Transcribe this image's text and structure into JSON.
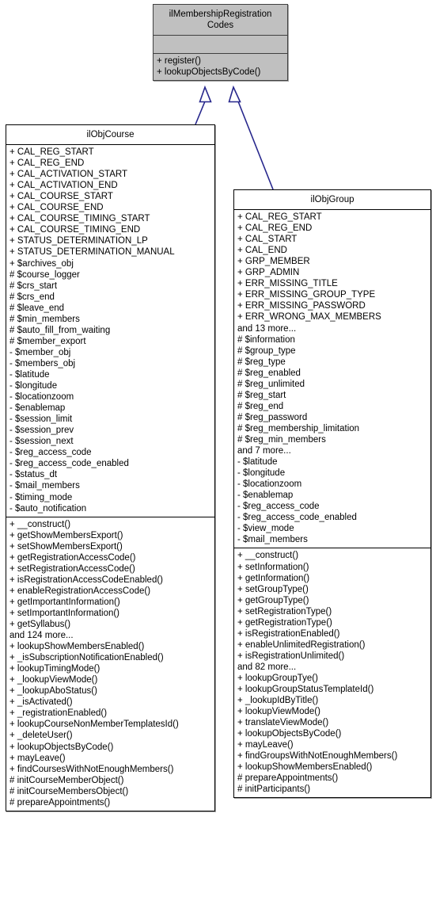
{
  "diagram": {
    "type": "uml-class-diagram",
    "background": "#ffffff",
    "edge_color": "#26268c",
    "interface_fill": "#c0c0c0",
    "class_fill": "#ffffff",
    "border_color": "#000000"
  },
  "classes": {
    "membership_registration_codes": {
      "name": "ilMembershipRegistration\nCodes",
      "attributes": [],
      "methods": [
        "+ register()",
        "+ lookupObjectsByCode()"
      ]
    },
    "obj_course": {
      "name": "ilObjCourse",
      "attributes": [
        "+ CAL_REG_START",
        "+ CAL_REG_END",
        "+ CAL_ACTIVATION_START",
        "+ CAL_ACTIVATION_END",
        "+ CAL_COURSE_START",
        "+ CAL_COURSE_END",
        "+ CAL_COURSE_TIMING_START",
        "+ CAL_COURSE_TIMING_END",
        "+ STATUS_DETERMINATION_LP",
        "+ STATUS_DETERMINATION_MANUAL",
        "+ $archives_obj",
        "# $course_logger",
        "# $crs_start",
        "# $crs_end",
        "# $leave_end",
        "# $min_members",
        "# $auto_fill_from_waiting",
        "# $member_export",
        "- $member_obj",
        "- $members_obj",
        "- $latitude",
        "- $longitude",
        "- $locationzoom",
        "- $enablemap",
        "- $session_limit",
        "- $session_prev",
        "- $session_next",
        "- $reg_access_code",
        "- $reg_access_code_enabled",
        "- $status_dt",
        "- $mail_members",
        "- $timing_mode",
        "- $auto_notification"
      ],
      "methods": [
        "+ __construct()",
        "+ getShowMembersExport()",
        "+ setShowMembersExport()",
        "+ getRegistrationAccessCode()",
        "+ setRegistrationAccessCode()",
        "+ isRegistrationAccessCodeEnabled()",
        "+ enableRegistrationAccessCode()",
        "+ getImportantInformation()",
        "+ setImportantInformation()",
        "+ getSyllabus()",
        "and 124 more...",
        "+ lookupShowMembersEnabled()",
        "+ _isSubscriptionNotificationEnabled()",
        "+ lookupTimingMode()",
        "+ _lookupViewMode()",
        "+ _lookupAboStatus()",
        "+ _isActivated()",
        "+ _registrationEnabled()",
        "+ lookupCourseNonMemberTemplatesId()",
        "+ _deleteUser()",
        "+ lookupObjectsByCode()",
        "+ mayLeave()",
        "+ findCoursesWithNotEnoughMembers()",
        "# initCourseMemberObject()",
        "# initCourseMembersObject()",
        "# prepareAppointments()"
      ]
    },
    "obj_group": {
      "name": "ilObjGroup",
      "attributes": [
        "+ CAL_REG_START",
        "+ CAL_REG_END",
        "+ CAL_START",
        "+ CAL_END",
        "+ GRP_MEMBER",
        "+ GRP_ADMIN",
        "+ ERR_MISSING_TITLE",
        "+ ERR_MISSING_GROUP_TYPE",
        "+ ERR_MISSING_PASSWORD",
        "+ ERR_WRONG_MAX_MEMBERS",
        "and 13 more...",
        "# $information",
        "# $group_type",
        "# $reg_type",
        "# $reg_enabled",
        "# $reg_unlimited",
        "# $reg_start",
        "# $reg_end",
        "# $reg_password",
        "# $reg_membership_limitation",
        "# $reg_min_members",
        "and 7 more...",
        "- $latitude",
        "- $longitude",
        "- $locationzoom",
        "- $enablemap",
        "- $reg_access_code",
        "- $reg_access_code_enabled",
        "- $view_mode",
        "- $mail_members"
      ],
      "methods": [
        "+ __construct()",
        "+ setInformation()",
        "+ getInformation()",
        "+ setGroupType()",
        "+ getGroupType()",
        "+ setRegistrationType()",
        "+ getRegistrationType()",
        "+ isRegistrationEnabled()",
        "+ enableUnlimitedRegistration()",
        "+ isRegistrationUnlimited()",
        "and 82 more...",
        "+ lookupGroupTye()",
        "+ lookupGroupStatusTemplateId()",
        "+ _lookupIdByTitle()",
        "+ lookupViewMode()",
        "+ translateViewMode()",
        "+ lookupObjectsByCode()",
        "+ mayLeave()",
        "+ findGroupsWithNotEnoughMembers()",
        "+ lookupShowMembersEnabled()",
        "# prepareAppointments()",
        "# initParticipants()"
      ]
    }
  },
  "relationships": [
    {
      "from": "ilObjCourse",
      "to": "ilMembershipRegistrationCodes",
      "kind": "generalization",
      "arrow": "hollow-triangle"
    },
    {
      "from": "ilObjGroup",
      "to": "ilMembershipRegistrationCodes",
      "kind": "generalization",
      "arrow": "hollow-triangle"
    }
  ]
}
